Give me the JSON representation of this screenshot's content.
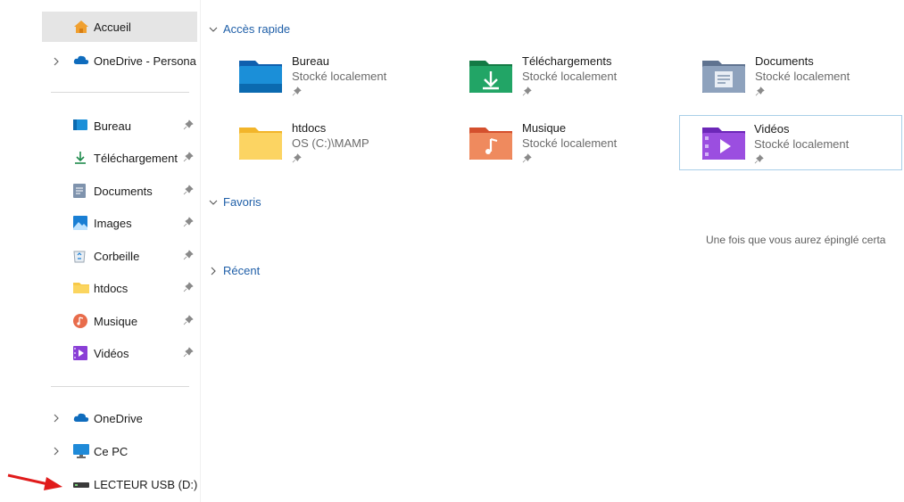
{
  "sidebar": {
    "home": {
      "label": "Accueil"
    },
    "onedrive_personal": {
      "label": "OneDrive - Persona"
    },
    "quick_items": [
      {
        "label": "Bureau",
        "icon": "desktop-icon"
      },
      {
        "label": "Téléchargement",
        "icon": "download-icon"
      },
      {
        "label": "Documents",
        "icon": "documents-icon"
      },
      {
        "label": "Images",
        "icon": "images-icon"
      },
      {
        "label": "Corbeille",
        "icon": "recycle-bin-icon"
      },
      {
        "label": "htdocs",
        "icon": "folder-icon"
      },
      {
        "label": "Musique",
        "icon": "music-icon"
      },
      {
        "label": "Vidéos",
        "icon": "videos-icon"
      }
    ],
    "onedrive": {
      "label": "OneDrive"
    },
    "this_pc": {
      "label": "Ce PC"
    },
    "usb": {
      "label": "LECTEUR USB (D:)"
    }
  },
  "main": {
    "quick_access": {
      "title": "Accès rapide",
      "tiles": [
        {
          "title": "Bureau",
          "subtitle": "Stocké localement",
          "icon": "desktop-folder-icon"
        },
        {
          "title": "Téléchargements",
          "subtitle": "Stocké localement",
          "icon": "downloads-folder-icon"
        },
        {
          "title": "Documents",
          "subtitle": "Stocké localement",
          "icon": "documents-folder-icon"
        },
        {
          "title": "htdocs",
          "subtitle": "OS (C:)\\MAMP",
          "icon": "folder-icon"
        },
        {
          "title": "Musique",
          "subtitle": "Stocké localement",
          "icon": "music-folder-icon"
        },
        {
          "title": "Vidéos",
          "subtitle": "Stocké localement",
          "icon": "videos-folder-icon"
        }
      ]
    },
    "favorites": {
      "title": "Favoris",
      "empty_message": "Une fois que vous aurez épinglé certa"
    },
    "recent": {
      "title": "Récent"
    }
  },
  "colors": {
    "accent": "#1f5fa8",
    "selected_bg": "#e5e5e5",
    "annotation_arrow": "#e01b1b"
  }
}
